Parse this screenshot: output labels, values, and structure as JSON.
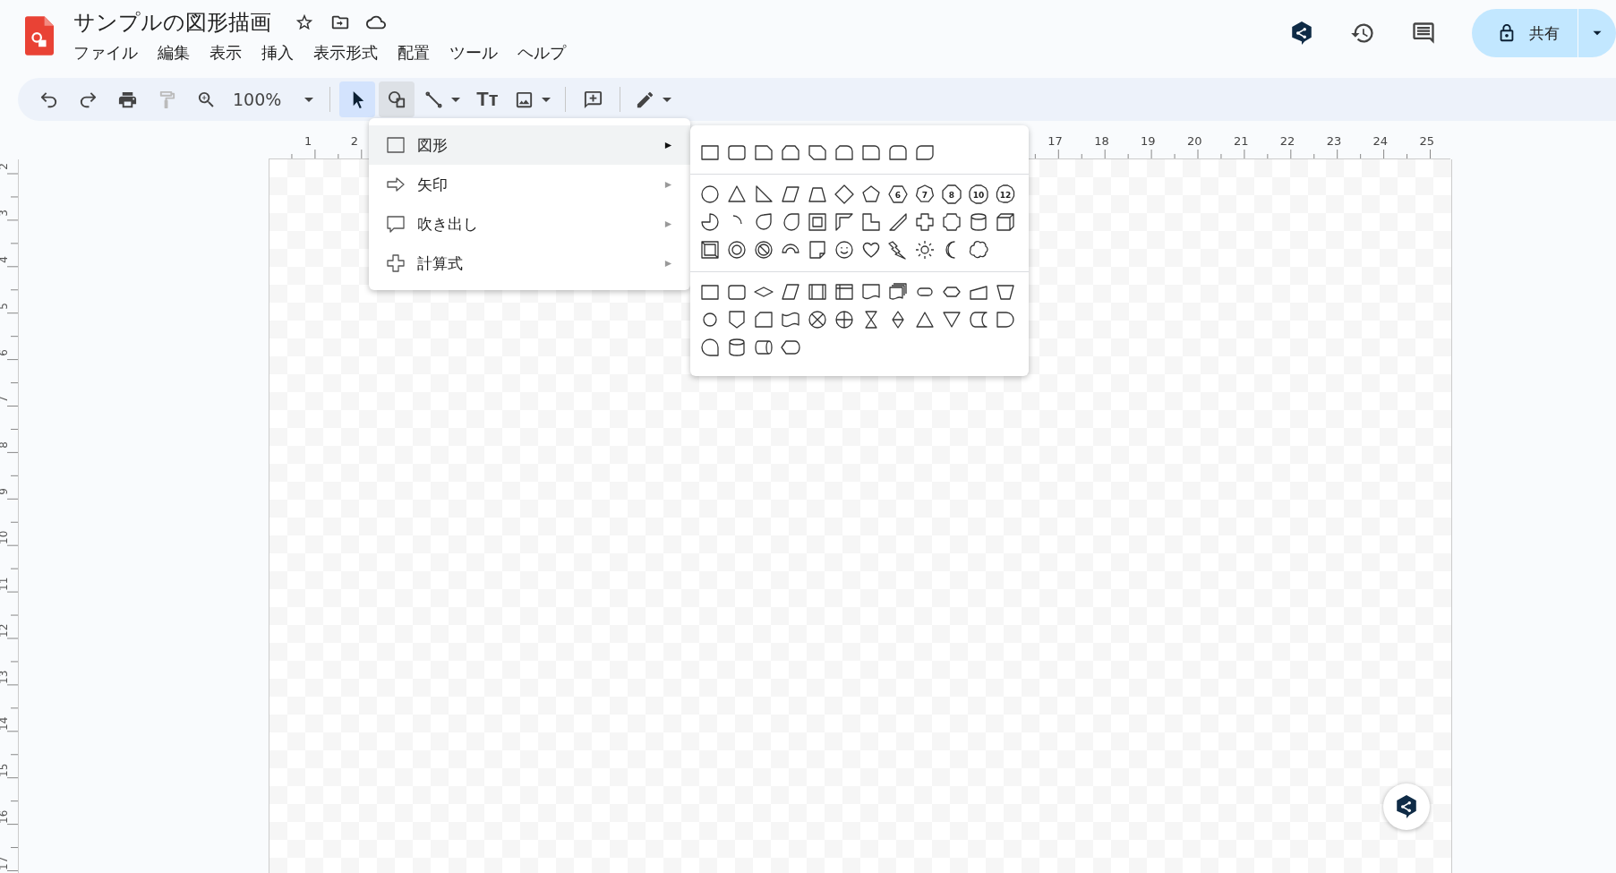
{
  "document": {
    "title": "サンプルの図形描画"
  },
  "menu_bar": [
    "ファイル",
    "編集",
    "表示",
    "挿入",
    "表示形式",
    "配置",
    "ツール",
    "ヘルプ"
  ],
  "share_button": {
    "label": "共有"
  },
  "toolbar": {
    "groups": [
      [
        {
          "kind": "undo",
          "disabled": false,
          "selected": false,
          "expanded": false,
          "dropdown": false
        },
        {
          "kind": "redo",
          "disabled": false,
          "selected": false,
          "expanded": false,
          "dropdown": false
        },
        {
          "kind": "print",
          "disabled": false,
          "selected": false,
          "expanded": false,
          "dropdown": false
        },
        {
          "kind": "paint_format",
          "disabled": true,
          "selected": false,
          "expanded": false,
          "dropdown": false
        },
        {
          "kind": "zoom_in",
          "disabled": false,
          "selected": false,
          "expanded": false,
          "dropdown": false
        },
        {
          "kind": "zoom_level",
          "label": "100%",
          "disabled": false,
          "selected": false,
          "expanded": false,
          "dropdown": true
        }
      ],
      [
        {
          "kind": "select",
          "disabled": false,
          "selected": true,
          "expanded": false,
          "dropdown": false
        },
        {
          "kind": "shape",
          "disabled": false,
          "selected": false,
          "expanded": true,
          "dropdown": false
        },
        {
          "kind": "line",
          "disabled": false,
          "selected": false,
          "expanded": false,
          "dropdown": true
        },
        {
          "kind": "text_box",
          "label": "Tт",
          "disabled": false,
          "selected": false,
          "expanded": false,
          "dropdown": false
        },
        {
          "kind": "image",
          "disabled": false,
          "selected": false,
          "expanded": false,
          "dropdown": true
        }
      ],
      [
        {
          "kind": "comment",
          "disabled": false,
          "selected": false,
          "expanded": false,
          "dropdown": false
        }
      ],
      [
        {
          "kind": "pen",
          "disabled": false,
          "selected": false,
          "expanded": false,
          "dropdown": true
        }
      ]
    ]
  },
  "horizontal_ruler": [
    "1",
    "2",
    "17",
    "18",
    "19",
    "20",
    "21",
    "22",
    "23",
    "24",
    "25"
  ],
  "vertical_ruler": [
    "2",
    "3",
    "4",
    "5",
    "6",
    "7",
    "8",
    "9",
    "10",
    "11",
    "12",
    "13",
    "14",
    "15",
    "16",
    "17"
  ],
  "insert_menu": {
    "items": [
      {
        "kind": "shape",
        "label": "図形",
        "selected": true
      },
      {
        "kind": "arrow",
        "label": "矢印",
        "selected": false
      },
      {
        "kind": "callout",
        "label": "吹き出し",
        "selected": false
      },
      {
        "kind": "equation",
        "label": "計算式",
        "selected": false
      }
    ]
  },
  "shape_submenu": {
    "polygon_labels": [
      "6",
      "7",
      "8",
      "10",
      "12"
    ]
  }
}
